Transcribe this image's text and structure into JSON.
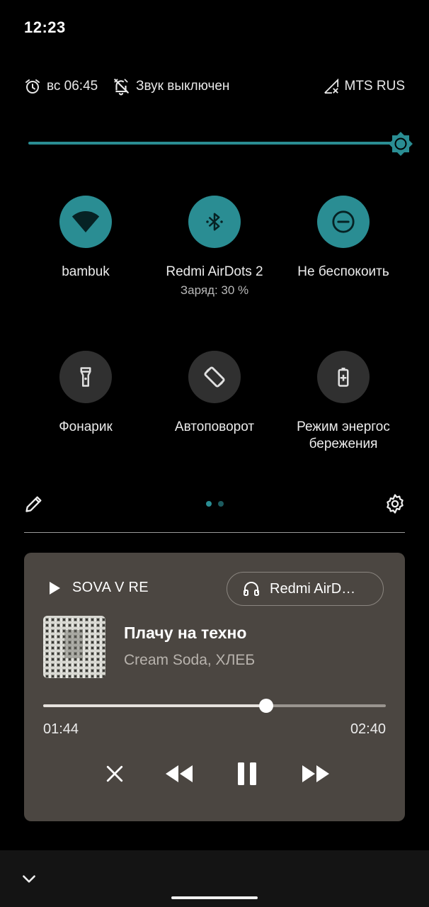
{
  "status_bar": {
    "time": "12:23"
  },
  "info_row": {
    "alarm_icon": "alarm-clock-icon",
    "alarm_text": "вс 06:45",
    "mute_icon": "bell-off-icon",
    "sound_text": "Звук выключен",
    "signal_icon": "no-signal-icon",
    "carrier_text": "MTS RUS"
  },
  "brightness": {
    "level": 1.0,
    "icon": "brightness-icon"
  },
  "colors": {
    "accent": "#2a8d93",
    "tile_off": "#303030",
    "media_bg": "#4b4641",
    "background": "#000000",
    "nav_bg": "#141414"
  },
  "tiles": [
    {
      "label": "bambuk",
      "sub": "",
      "icon": "wifi-icon",
      "active": true
    },
    {
      "label": "Redmi AirDots 2",
      "sub": "Заряд: 30 %",
      "icon": "bluetooth-icon",
      "active": true
    },
    {
      "label": "Не беспокоить",
      "sub": "",
      "icon": "do-not-disturb-icon",
      "active": true
    },
    {
      "label": "Фонарик",
      "sub": "",
      "icon": "flashlight-icon",
      "active": false
    },
    {
      "label": "Автоповорот",
      "sub": "",
      "icon": "auto-rotate-icon",
      "active": false
    },
    {
      "label": "Режим энергос бережения",
      "sub": "",
      "icon": "battery-saver-icon",
      "active": false
    }
  ],
  "pager": {
    "pages": 2,
    "current": 1
  },
  "media": {
    "app_name": "SOVA V RE",
    "output_device": "Redmi AirD…",
    "track_title": "Плачу на техно",
    "track_artist": "Cream Soda, ХЛЕБ",
    "progress": 0.65,
    "time_current": "01:44",
    "time_total": "02:40"
  }
}
